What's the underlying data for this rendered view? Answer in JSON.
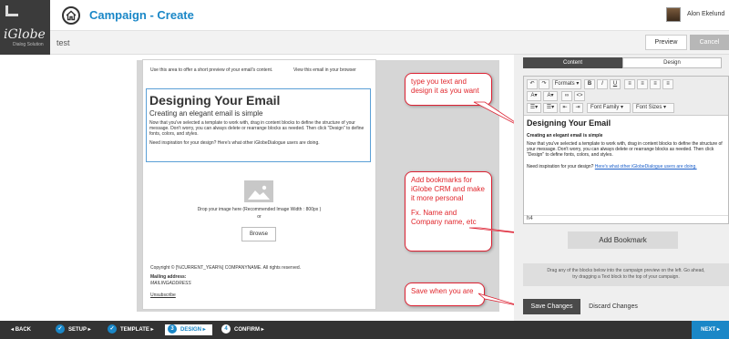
{
  "header": {
    "brand": "iGlobe",
    "tagline": "Dialog Solution",
    "title": "Campaign - Create",
    "user_name": "Alon Ekelund"
  },
  "subbar": {
    "campaign_name": "test",
    "preview_label": "Preview",
    "cancel_label": "Cancel"
  },
  "email": {
    "preheader": "Use this area to offer a short preview of your email's content.",
    "view_in_browser": "View this email in your browser",
    "heading": "Designing Your Email",
    "subheading": "Creating an elegant email is simple",
    "body": "Now that you've selected a template to work with, drag in content blocks to define the structure of your message. Don't worry, you can always delete or rearrange blocks as needed. Then click \"Design\" to define fonts, colors, and styles.",
    "inspiration": "Need inspiration for your design? Here's what other iGlobeDialogue users are doing.",
    "drop_text": "Drop your image here (Recommended Image Width : 800px )",
    "or": "or",
    "browse_label": "Browse",
    "copyright": "Copyright © [%CURRENT_YEAR%] COMPANYNAME. All rights reserved.",
    "mailing_label": "Mailing address:",
    "mailing_address": "MAILINGADDRESS",
    "unsubscribe": "Unsubscribe"
  },
  "callouts": {
    "text1": "type you text and design it as you want",
    "text2a": "Add bookmarks for iGlobe CRM and make it more personal",
    "text2b": "Fx. Name and Company name, etc",
    "text3": "Save when you are"
  },
  "panel": {
    "tab_content": "Content",
    "tab_design": "Design",
    "toolbar": {
      "formats": "Formats",
      "bold": "B",
      "italic": "I",
      "underline": "U",
      "font_family": "Font Family",
      "font_sizes": "Font Sizes"
    },
    "editor_heading": "Designing Your Email",
    "editor_sub": "Creating an elegant email is simple",
    "editor_body": "Now that you've selected a template to work with, drag in content blocks to define the structure of your message. Don't worry, you can always delete or rearrange blocks as needed. Then click \"Design\" to define fonts, colors, and styles.",
    "editor_insp_prefix": "Need inspiration for your design? ",
    "editor_insp_link": "Here's what other iGlobeDialogue users are doing.",
    "status_path": "h4",
    "bookmark_label": "Add Bookmark",
    "drag_hint_1": "Drag any of the blocks below into the campaign preview on the left. Go ahead,",
    "drag_hint_2": "try dragging a Text block to the top of your campaign.",
    "save_label": "Save Changes",
    "discard_label": "Discard Changes"
  },
  "footer": {
    "back": "BACK",
    "steps": [
      {
        "num": "",
        "label": "SETUP"
      },
      {
        "num": "",
        "label": "TEMPLATE"
      },
      {
        "num": "3",
        "label": "DESIGN"
      },
      {
        "num": "4",
        "label": "CONFIRM"
      }
    ],
    "next": "NEXT"
  },
  "colors": {
    "accent": "#1a87c7",
    "callout_text": "#e0262c",
    "dark": "#333333"
  }
}
